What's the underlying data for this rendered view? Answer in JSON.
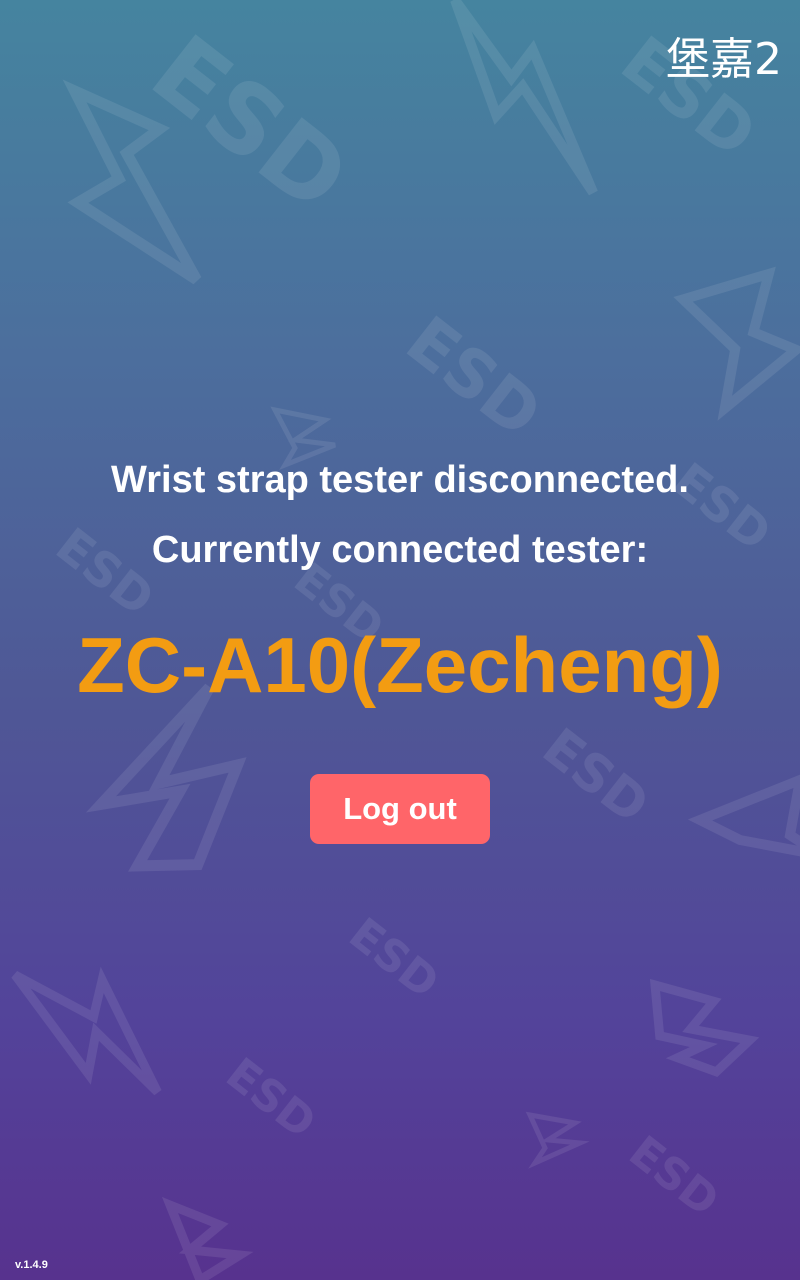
{
  "header": {
    "device_name": "堡嘉2"
  },
  "status": {
    "line1": "Wrist strap tester disconnected.",
    "line2": "Currently connected tester:"
  },
  "tester": {
    "name": "ZC-A10(Zecheng)"
  },
  "actions": {
    "logout_label": "Log out"
  },
  "footer": {
    "version": "v.1.4.9"
  },
  "colors": {
    "gradient_top": "#45849F",
    "gradient_bottom": "#57328E",
    "tester_name": "#F39C12",
    "logout_button": "#FF6569",
    "text": "#FFFFFF"
  },
  "background": {
    "watermark_text": "ESD",
    "watermark_icon": "lightning-bolt-icon"
  }
}
